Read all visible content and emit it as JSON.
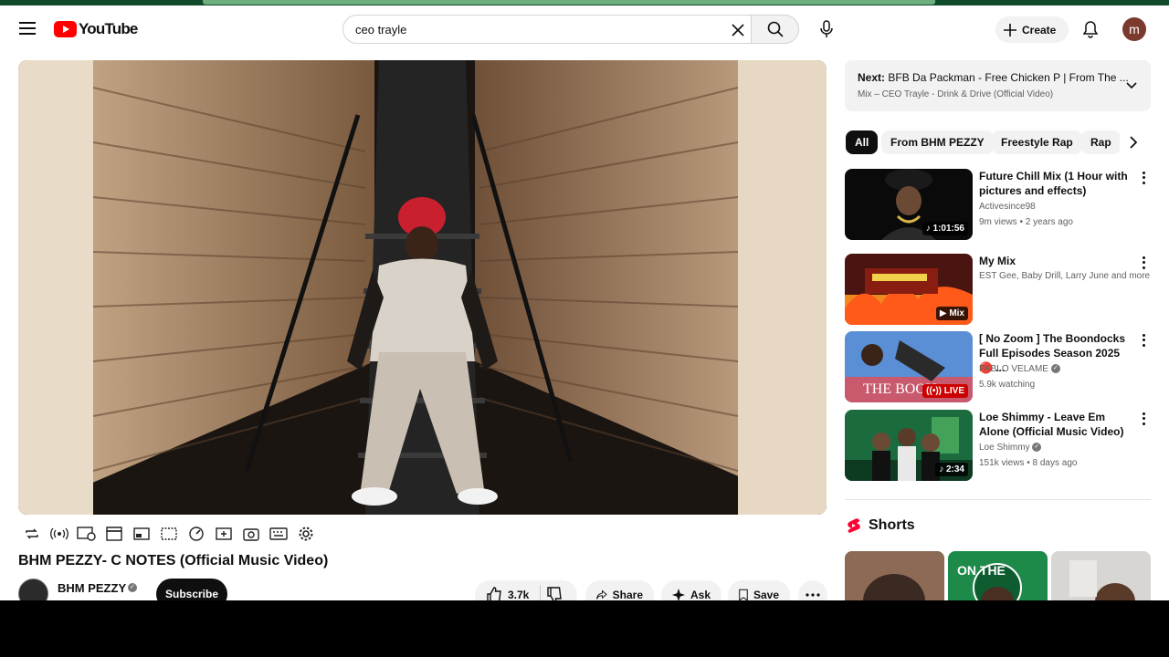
{
  "header": {
    "logo_text": "YouTube",
    "search_value": "ceo trayle",
    "create_label": "Create",
    "avatar_letter": "m"
  },
  "video": {
    "title": "BHM PEZZY- C NOTES (Official Music Video)",
    "channel": "BHM PEZZY",
    "subscribe_label": "Subscribe",
    "likes": "3.7k",
    "share_label": "Share",
    "ask_label": "Ask",
    "save_label": "Save"
  },
  "next_up": {
    "prefix": "Next:",
    "title": "BFB Da Packman - Free Chicken P | From The ...",
    "subtitle": "Mix – CEO Trayle - Drink & Drive (Official Video)"
  },
  "chips": [
    "All",
    "From BHM PEZZY",
    "Freestyle Rap",
    "Rap"
  ],
  "recommendations": [
    {
      "title": "Future Chill Mix (1 Hour with pictures and effects)",
      "channel": "Activesince98",
      "meta": "9m views • 2 years ago",
      "badge": "♪ 1:01:56",
      "colors": [
        "#0a0a0a",
        "#6a6a6a"
      ]
    },
    {
      "title": "My Mix",
      "channel": "EST Gee, Baby Drill, Larry June and more",
      "meta": "",
      "badge": "▶ Mix",
      "colors": [
        "#8a1d12",
        "#f08a1e"
      ]
    },
    {
      "title": "[ No Zoom ] The Boondocks Full Episodes Season 2025 🔴 ...",
      "channel": "PABLO VELAME",
      "meta": "5.9k watching",
      "badge": "((•)) LIVE",
      "colors": [
        "#5a8fd6",
        "#c95a6e"
      ]
    },
    {
      "title": "Loe Shimmy - Leave Em Alone (Official Music Video)",
      "channel": "Loe Shimmy",
      "meta": "151k views • 8 days ago",
      "badge": "♪ 2:34",
      "colors": [
        "#1c6b3e",
        "#5ec46d"
      ]
    }
  ],
  "shorts": {
    "title": "Shorts",
    "thumb_colors": [
      "#3b2a22",
      "#1d8a4a",
      "#d8d6d2"
    ]
  },
  "colors": {
    "brand_red": "#ff0000",
    "chip_active": "#0f0f0f"
  }
}
